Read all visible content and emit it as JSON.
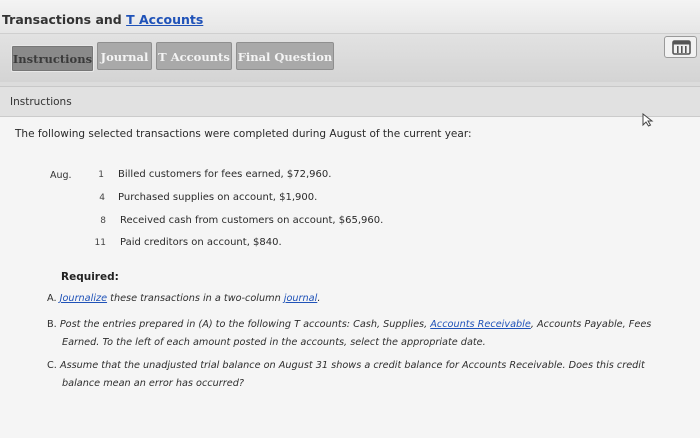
{
  "page": {
    "title_prefix": "Transactions and ",
    "title_link": "T Accounts"
  },
  "tabs": [
    {
      "label": "Instructions",
      "active": true
    },
    {
      "label": "Journal",
      "active": false
    },
    {
      "label": "T Accounts",
      "active": false
    },
    {
      "label": "Final Question",
      "active": false
    }
  ],
  "toolbar": {
    "icon": "notepad-icon"
  },
  "panel": {
    "header": "Instructions",
    "intro": "The following selected transactions were completed during August of the current year:",
    "month": "Aug.",
    "transactions": [
      {
        "day": "1",
        "text": "Billed customers for fees earned, $72,960."
      },
      {
        "day": "4",
        "text": "Purchased supplies on account, $1,900."
      },
      {
        "day": "8",
        "text": "Received cash from customers on account, $65,960."
      },
      {
        "day": "11",
        "text": "Paid creditors on account, $840."
      }
    ],
    "required_title": "Required:",
    "req_a": {
      "label": "A.",
      "link1": "Journalize",
      "text1": " these transactions in a two-column ",
      "link2": "journal",
      "text2": "."
    },
    "req_b": {
      "label": "B.",
      "text1": "Post the entries prepared in (A) to the following T accounts: Cash, Supplies, ",
      "link": "Accounts Receivable",
      "text2": ", Accounts Payable, Fees",
      "line2": "Earned. To the left of each amount posted in the accounts, select the appropriate date."
    },
    "req_c": {
      "label": "C.",
      "line1": "Assume that the unadjusted trial balance on August 31 shows a credit balance for Accounts Receivable. Does this credit",
      "line2": "balance mean an error has occurred?"
    }
  }
}
